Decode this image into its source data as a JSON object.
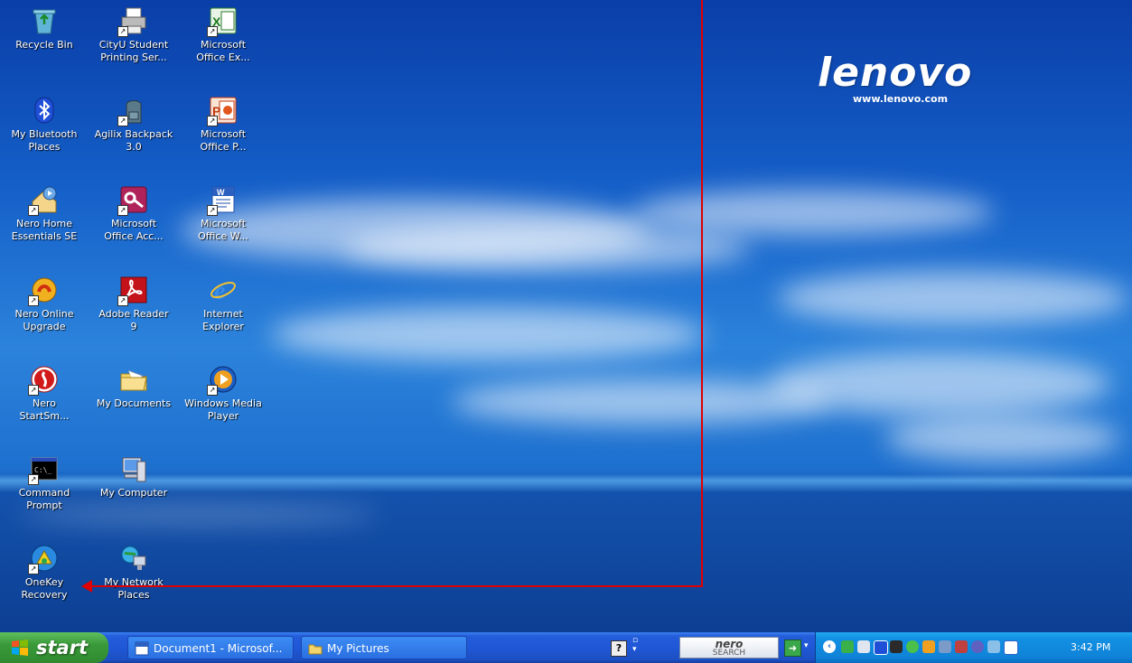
{
  "wallpaper": {
    "logo_text": "lenovo",
    "url_text": "www.lenovo.com"
  },
  "desktop_icons": [
    {
      "name": "recycle-bin",
      "label": "Recycle Bin",
      "icon": "recycle-bin-icon"
    },
    {
      "name": "cityu-student-printing",
      "label": "CityU Student\nPrinting Ser...",
      "icon": "printer-icon"
    },
    {
      "name": "microsoft-office-excel",
      "label": "Microsoft\nOffice Ex...",
      "icon": "excel-icon"
    },
    {
      "name": "my-bluetooth-places",
      "label": "My Bluetooth\nPlaces",
      "icon": "bluetooth-icon"
    },
    {
      "name": "agilix-backpack",
      "label": "Agilix Backpack\n3.0",
      "icon": "backpack-icon"
    },
    {
      "name": "microsoft-office-powerpoint",
      "label": "Microsoft\nOffice P...",
      "icon": "powerpoint-icon"
    },
    {
      "name": "nero-home-essentials",
      "label": "Nero Home\nEssentials SE",
      "icon": "nero-home-icon"
    },
    {
      "name": "microsoft-office-access",
      "label": "Microsoft\nOffice Acc...",
      "icon": "access-icon"
    },
    {
      "name": "microsoft-office-word",
      "label": "Microsoft\nOffice W...",
      "icon": "word-icon"
    },
    {
      "name": "nero-online-upgrade",
      "label": "Nero Online\nUpgrade",
      "icon": "nero-upgrade-icon"
    },
    {
      "name": "adobe-reader",
      "label": "Adobe Reader\n9",
      "icon": "adobe-reader-icon"
    },
    {
      "name": "internet-explorer",
      "label": "Internet\nExplorer",
      "icon": "internet-explorer-icon"
    },
    {
      "name": "nero-startsmart",
      "label": "Nero\nStartSm...",
      "icon": "nero-startsmart-icon"
    },
    {
      "name": "my-documents",
      "label": "My Documents",
      "icon": "folder-documents-icon"
    },
    {
      "name": "windows-media-player",
      "label": "Windows Media\nPlayer",
      "icon": "media-player-icon"
    },
    {
      "name": "command-prompt",
      "label": "Command\nPrompt",
      "icon": "command-prompt-icon"
    },
    {
      "name": "my-computer",
      "label": "My Computer",
      "icon": "computer-icon"
    },
    {
      "name": "onekey-recovery",
      "label": "OneKey\nRecovery",
      "icon": "onekey-recovery-icon"
    },
    {
      "name": "my-network-places",
      "label": "My Network\nPlaces",
      "icon": "network-places-icon"
    }
  ],
  "taskbar": {
    "start_label": "start",
    "tasks": [
      {
        "label": "Document1 - Microsof...",
        "icon": "word-document-icon"
      },
      {
        "label": "My Pictures",
        "icon": "folder-icon"
      }
    ],
    "help_label": "?",
    "nero_search_top": "nero",
    "nero_search_bottom": "SEARCH",
    "clock": "3:42 PM"
  },
  "colors": {
    "annotation_red": "#e00000",
    "taskbar_blue": "#245edb",
    "start_green": "#3a9a3a"
  }
}
